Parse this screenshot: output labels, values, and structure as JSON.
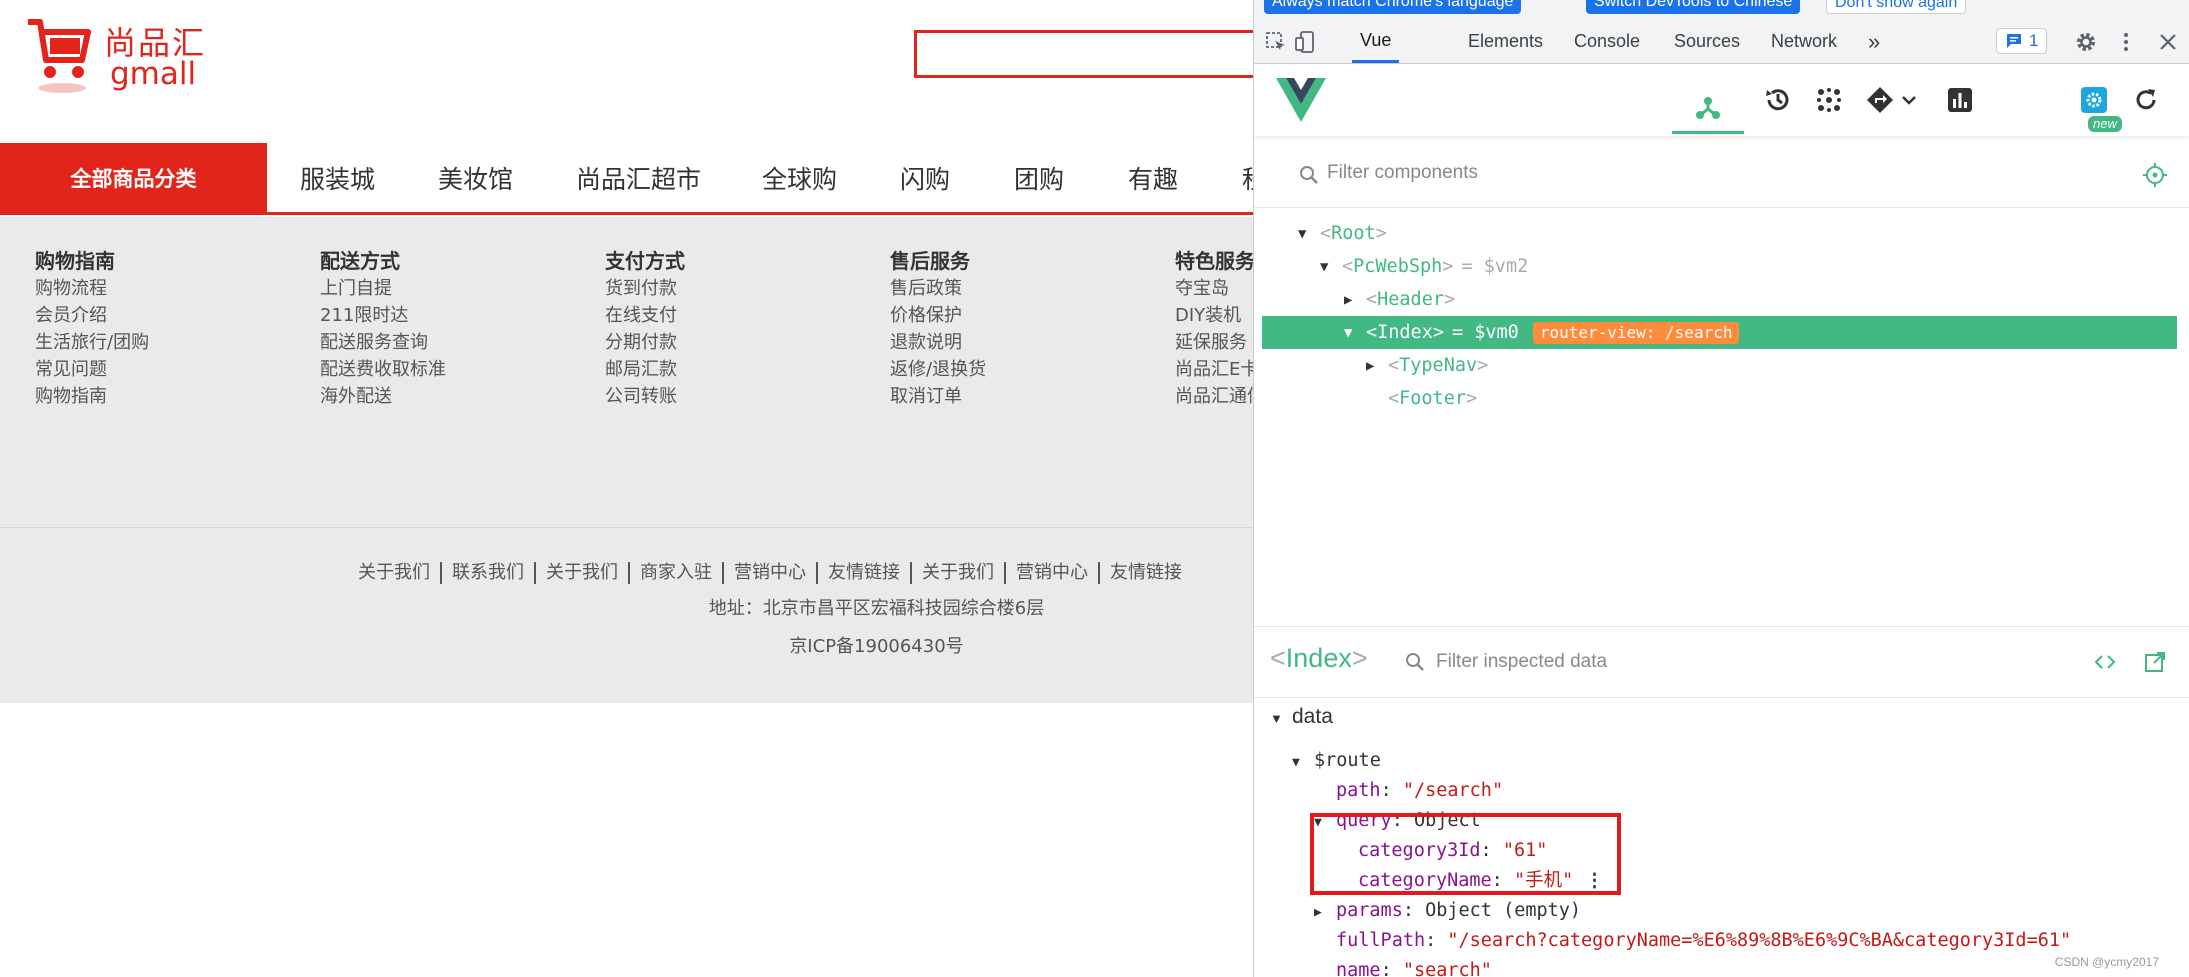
{
  "site": {
    "logo": {
      "brand_cn": "尚品汇",
      "brand_en": "gmall"
    },
    "nav": {
      "all_categories": "全部商品分类",
      "items": [
        "服装城",
        "美妆馆",
        "尚品汇超市",
        "全球购",
        "闪购",
        "团购",
        "有趣",
        "秒"
      ]
    },
    "services": [
      {
        "title": "购物指南",
        "items": [
          "购物流程",
          "会员介绍",
          "生活旅行/团购",
          "常见问题",
          "购物指南"
        ]
      },
      {
        "title": "配送方式",
        "items": [
          "上门自提",
          "211限时达",
          "配送服务查询",
          "配送费收取标准",
          "海外配送"
        ]
      },
      {
        "title": "支付方式",
        "items": [
          "货到付款",
          "在线支付",
          "分期付款",
          "邮局汇款",
          "公司转账"
        ]
      },
      {
        "title": "售后服务",
        "items": [
          "售后政策",
          "价格保护",
          "退款说明",
          "返修/退换货",
          "取消订单"
        ]
      },
      {
        "title": "特色服务",
        "items": [
          "夺宝岛",
          "DIY装机",
          "延保服务",
          "尚品汇E卡",
          "尚品汇通信"
        ]
      }
    ],
    "footer_links": [
      "关于我们",
      "联系我们",
      "关于我们",
      "商家入驻",
      "营销中心",
      "友情链接",
      "关于我们",
      "营销中心",
      "友情链接"
    ],
    "address": "地址：北京市昌平区宏福科技园综合楼6层",
    "icp": "京ICP备19006430号"
  },
  "devtools": {
    "infobar": {
      "match_language": "Always match Chrome's language",
      "switch_chinese": "Switch DevTools to Chinese",
      "dont_show": "Don't show again"
    },
    "tabs": [
      "Vue",
      "Elements",
      "Console",
      "Sources",
      "Network"
    ],
    "more_tabs": "»",
    "issues_count": "1",
    "new_label": "new",
    "filter_components_placeholder": "Filter components",
    "tree": {
      "root": "Root",
      "pcwebsph": "PcWebSph",
      "pcwebsph_ref": "= $vm2",
      "header": "Header",
      "index": "Index",
      "index_ref": "= $vm0",
      "router_tag": "router-view: /search",
      "typenav": "TypeNav",
      "footer": "Footer"
    },
    "inspected": {
      "component_name": "Index",
      "filter_placeholder": "Filter inspected data",
      "section": "data",
      "route_key": "$route",
      "rows": {
        "path_key": "path",
        "path_val": "\"/search\"",
        "query_key": "query",
        "query_type": "Object",
        "category3id_key": "category3Id",
        "category3id_val": "\"61\"",
        "categoryname_key": "categoryName",
        "categoryname_val": "\"手机\"",
        "params_key": "params",
        "params_type": "Object (empty)",
        "fullpath_key": "fullPath",
        "fullpath_val": "\"/search?categoryName=%E6%89%8B%E6%9C%BA&category3Id=61\"",
        "name_key": "name",
        "name_val": "\"search\""
      }
    },
    "watermark": "CSDN @ycmy2017"
  },
  "colors": {
    "brand_red": "#e1251b",
    "vue_green": "#42b883",
    "router_orange": "#ff8c3a",
    "chrome_blue": "#1a73e8"
  }
}
